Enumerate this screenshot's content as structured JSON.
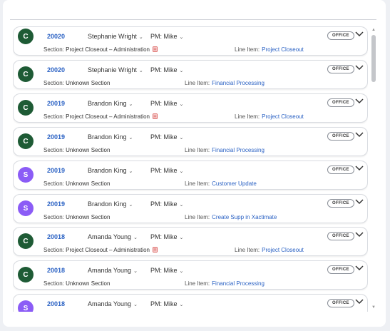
{
  "colors": {
    "green_avatar": "#1e5b35",
    "purple_avatar": "#8b5cf6",
    "link": "#2b62c4"
  },
  "labels": {
    "section_prefix": "Section:",
    "line_item_prefix": "Line Item:",
    "pm_prefix": "PM:"
  },
  "rows": [
    {
      "avatar": "C",
      "avatar_color": "green",
      "job": "20020",
      "person": "Stephanie Wright",
      "pm": "Mike",
      "badge": "OFFICE",
      "section": "Project Closeout – Administration",
      "section_icon": true,
      "line_item": "Project Closeout"
    },
    {
      "avatar": "C",
      "avatar_color": "green",
      "job": "20020",
      "person": "Stephanie Wright",
      "pm": "Mike",
      "badge": "OFFICE",
      "section": "Unknown Section",
      "section_icon": false,
      "line_item": "Financial Processing"
    },
    {
      "avatar": "C",
      "avatar_color": "green",
      "job": "20019",
      "person": "Brandon King",
      "pm": "Mike",
      "badge": "OFFICE",
      "section": "Project Closeout – Administration",
      "section_icon": true,
      "line_item": "Project Closeout"
    },
    {
      "avatar": "C",
      "avatar_color": "green",
      "job": "20019",
      "person": "Brandon King",
      "pm": "Mike",
      "badge": "OFFICE",
      "section": "Unknown Section",
      "section_icon": false,
      "line_item": "Financial Processing"
    },
    {
      "avatar": "S",
      "avatar_color": "purple",
      "job": "20019",
      "person": "Brandon King",
      "pm": "Mike",
      "badge": "OFFICE",
      "section": "Unknown Section",
      "section_icon": false,
      "line_item": "Customer Update"
    },
    {
      "avatar": "S",
      "avatar_color": "purple",
      "job": "20019",
      "person": "Brandon King",
      "pm": "Mike",
      "badge": "OFFICE",
      "section": "Unknown Section",
      "section_icon": false,
      "line_item": "Create Supp in Xactimate"
    },
    {
      "avatar": "C",
      "avatar_color": "green",
      "job": "20018",
      "person": "Amanda Young",
      "pm": "Mike",
      "badge": "OFFICE",
      "section": "Project Closeout – Administration",
      "section_icon": true,
      "line_item": "Project Closeout"
    },
    {
      "avatar": "C",
      "avatar_color": "green",
      "job": "20018",
      "person": "Amanda Young",
      "pm": "Mike",
      "badge": "OFFICE",
      "section": "Unknown Section",
      "section_icon": false,
      "line_item": "Financial Processing"
    },
    {
      "avatar": "S",
      "avatar_color": "purple",
      "job": "20018",
      "person": "Amanda Young",
      "pm": "Mike",
      "badge": "OFFICE",
      "section": "",
      "section_icon": false,
      "line_item": ""
    }
  ]
}
